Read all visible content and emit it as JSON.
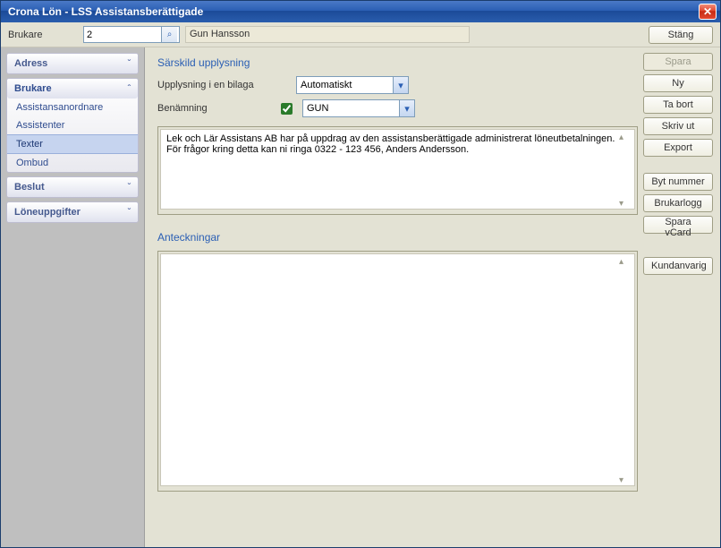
{
  "window": {
    "title": "Crona Lön - LSS Assistansberättigade"
  },
  "topbar": {
    "label": "Brukare",
    "code": "2",
    "name": "Gun Hansson",
    "close_label": "Stäng"
  },
  "nav": {
    "groups": [
      {
        "label": "Adress",
        "expanded": false
      },
      {
        "label": "Brukare",
        "expanded": true,
        "items": [
          "Assistansanordnare",
          "Assistenter",
          "Texter",
          "Ombud"
        ],
        "selected_index": 2
      },
      {
        "label": "Beslut",
        "expanded": false
      },
      {
        "label": "Löneuppgifter",
        "expanded": false
      }
    ]
  },
  "center": {
    "section1_title": "Särskild upplysning",
    "upplysning_label": "Upplysning i en bilaga",
    "upplysning_value": "Automatiskt",
    "benamning_label": "Benämning",
    "benamning_checked": true,
    "benamning_value": "GUN",
    "upplysning_text": "Lek och Lär Assistans AB har på uppdrag av den assistansberättigade administrerat löneutbetalningen. För frågor kring detta kan ni ringa 0322 - 123 456, Anders Andersson.",
    "section2_title": "Anteckningar",
    "anteckningar_text": ""
  },
  "buttons": {
    "spara": "Spara",
    "ny": "Ny",
    "ta_bort": "Ta bort",
    "skriv_ut": "Skriv ut",
    "export": "Export",
    "byt_nummer": "Byt nummer",
    "brukarlogg": "Brukarlogg",
    "spara_vcard": "Spara vCard",
    "kundanvarig": "Kundanvarig"
  }
}
